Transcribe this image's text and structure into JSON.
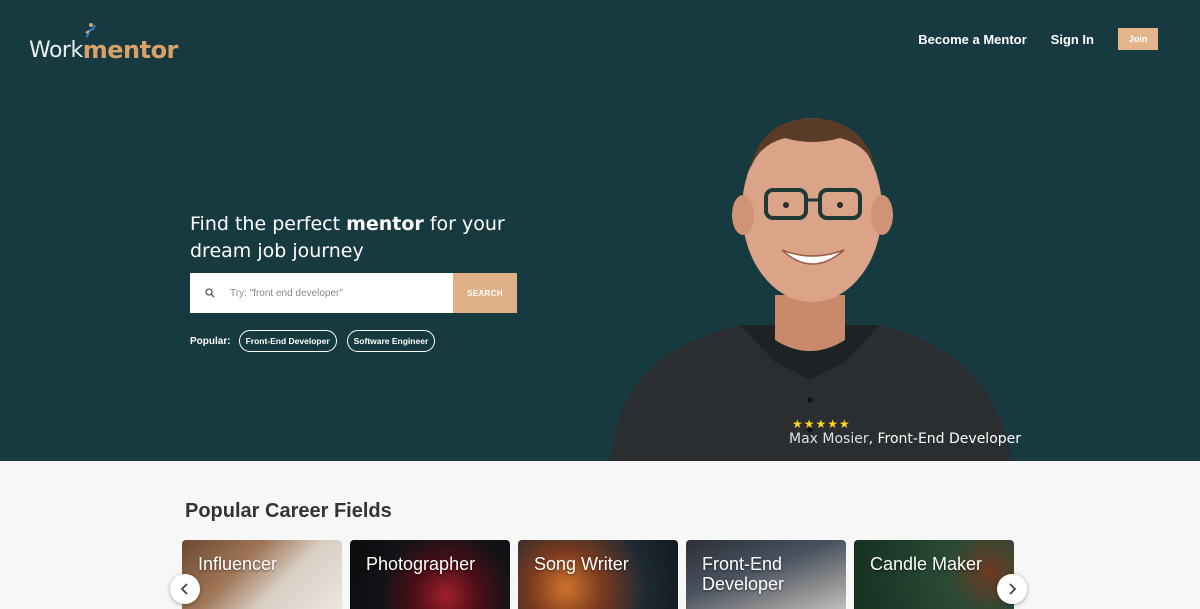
{
  "header": {
    "logo_work": "Work",
    "logo_mentor": "mentor",
    "nav": {
      "become_mentor": "Become a Mentor",
      "sign_in": "Sign In",
      "join": "Join"
    }
  },
  "hero": {
    "headline_pre": "Find the perfect ",
    "headline_bold": "mentor",
    "headline_post": " for your dream job journey",
    "search": {
      "placeholder": "Try: \"front end developer\"",
      "button": "SEARCH"
    },
    "popular": {
      "label": "Popular:",
      "chips": [
        "Front-End Developer",
        "Software Engineer"
      ]
    },
    "featured_mentor": {
      "rating_stars": "★★★★★",
      "name": "Max Mosier",
      "role": ", Front-End Developer"
    }
  },
  "careers": {
    "title": "Popular Career Fields",
    "fields": [
      {
        "label_line1": "Influencer",
        "label_line2": ""
      },
      {
        "label_line1": "Photographer",
        "label_line2": ""
      },
      {
        "label_line1": "Song Writer",
        "label_line2": ""
      },
      {
        "label_line1": "Front-End",
        "label_line2": "Developer"
      },
      {
        "label_line1": "Candle Maker",
        "label_line2": ""
      }
    ]
  },
  "colors": {
    "hero_bg": "#173a40",
    "accent": "#e0b186",
    "star": "#ffd21f"
  },
  "icons": {
    "search": "search-icon",
    "prev": "chevron-left-icon",
    "next": "chevron-right-icon"
  }
}
